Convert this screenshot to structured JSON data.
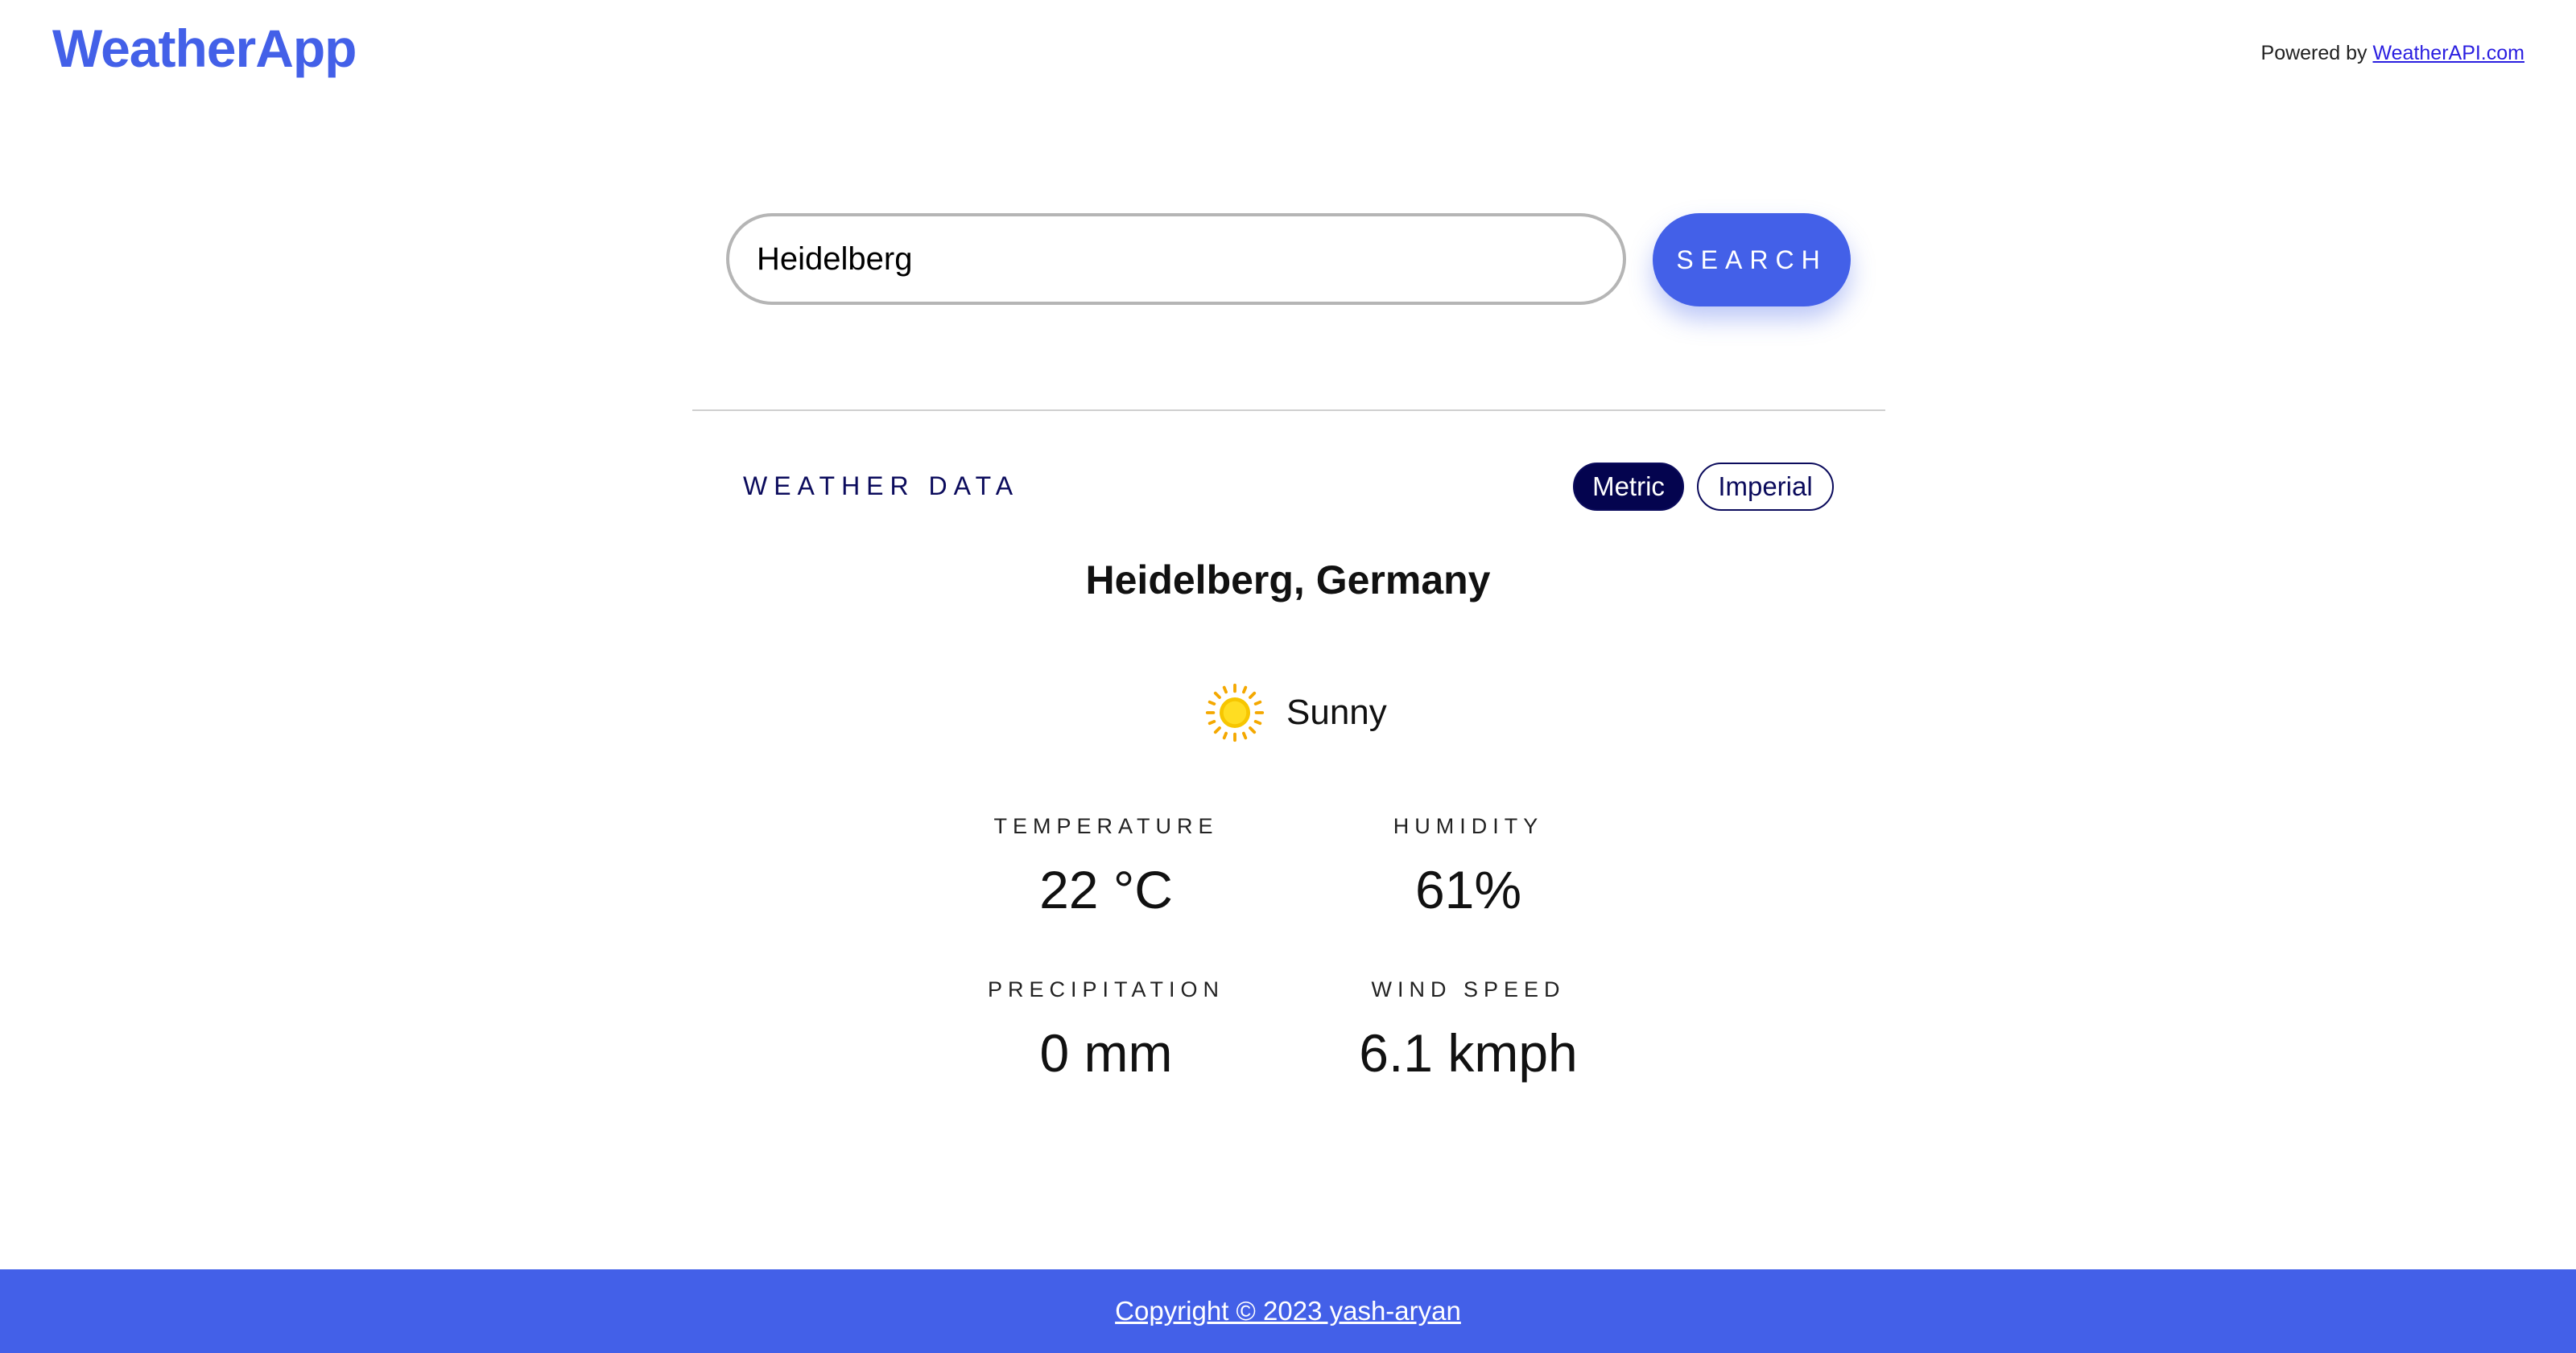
{
  "header": {
    "brand": "WeatherApp",
    "powered_prefix": "Powered by ",
    "powered_link": "WeatherAPI.com"
  },
  "search": {
    "value": "Heidelberg",
    "button_label": "SEARCH"
  },
  "weather": {
    "section_title": "WEATHER DATA",
    "units": {
      "metric_label": "Metric",
      "imperial_label": "Imperial",
      "selected": "Metric"
    },
    "location": "Heidelberg, Germany",
    "condition": {
      "icon": "sun-icon",
      "text": "Sunny"
    },
    "stats": {
      "temperature": {
        "label": "TEMPERATURE",
        "value": "22 °C"
      },
      "humidity": {
        "label": "HUMIDITY",
        "value": "61%"
      },
      "precipitation": {
        "label": "PRECIPITATION",
        "value": "0 mm"
      },
      "wind_speed": {
        "label": "WIND SPEED",
        "value": "6.1 kmph"
      }
    }
  },
  "footer": {
    "copyright": "Copyright © 2023 yash-aryan"
  },
  "colors": {
    "accent": "#4360e8",
    "navy": "#04044f",
    "sun": "#f7c600"
  }
}
